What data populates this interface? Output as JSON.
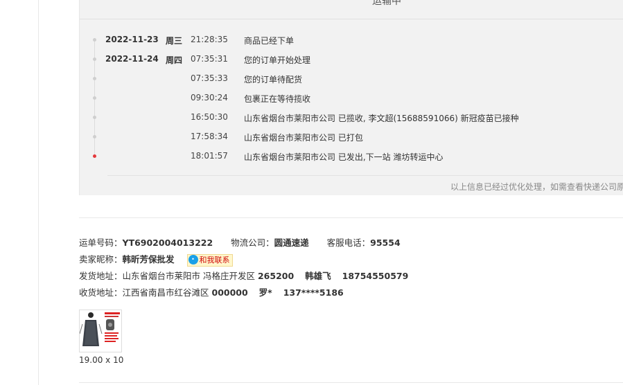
{
  "tracking": {
    "status_title": "运输中",
    "events": [
      {
        "date": "2022-11-23",
        "weekday": "周三",
        "time": "21:28:35",
        "text": "商品已经下单",
        "active": false
      },
      {
        "date": "2022-11-24",
        "weekday": "周四",
        "time": "07:35:31",
        "text": "您的订单开始处理",
        "active": false
      },
      {
        "date": "",
        "weekday": "",
        "time": "07:35:33",
        "text": "您的订单待配货",
        "active": false
      },
      {
        "date": "",
        "weekday": "",
        "time": "09:30:24",
        "text": "包裹正在等待揽收",
        "active": false
      },
      {
        "date": "",
        "weekday": "",
        "time": "16:50:30",
        "text": "山东省烟台市莱阳市公司 已揽收, 李文超(15688591066) 新冠疫苗已接种",
        "active": false
      },
      {
        "date": "",
        "weekday": "",
        "time": "17:58:34",
        "text": "山东省烟台市莱阳市公司 已打包",
        "active": false
      },
      {
        "date": "",
        "weekday": "",
        "time": "18:01:57",
        "text": "山东省烟台市莱阳市公司 已发出,下一站 潍坊转运中心",
        "active": true
      }
    ],
    "note": "以上信息已经过优化处理，如需查看快递公司原"
  },
  "info": {
    "waybill_label": "运单号码：",
    "waybill_value": "YT6902004013222",
    "carrier_label": "物流公司：",
    "carrier_value": "圆通速递",
    "service_label": "客服电话：",
    "service_value": "95554",
    "seller_label": "卖家昵称：",
    "seller_value": "韩昕芳保批发",
    "chat_label": "和我联系",
    "ship_from_label": "发货地址：",
    "ship_from_address": "山东省烟台市莱阳市 冯格庄开发区",
    "ship_from_zip": "265200",
    "ship_from_name": "韩雄飞",
    "ship_from_phone": "18754550579",
    "ship_to_label": "收货地址：",
    "ship_to_address": "江西省南昌市红谷滩区",
    "ship_to_zip": "000000",
    "ship_to_name": "罗*",
    "ship_to_phone": "137****5186"
  },
  "product": {
    "price_qty": "19.00 x 10",
    "image_label": "apron-product-thumbnail"
  },
  "colors": {
    "panel_bg": "#f2f2f2",
    "active_dot": "#e4393c",
    "chat_text": "#d10b0b",
    "chat_bg": "#fff7cc",
    "chat_icon": "#1aa0e8"
  }
}
